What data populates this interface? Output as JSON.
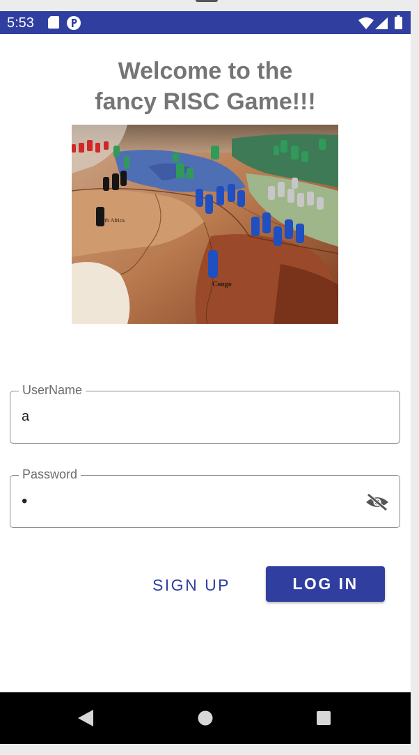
{
  "status_bar": {
    "time": "5:53",
    "background": "#303f9f",
    "icons": [
      "sd-card-icon",
      "p-notification-icon",
      "wifi-icon",
      "signal-icon",
      "battery-icon"
    ]
  },
  "title": {
    "line1": "Welcome to the",
    "line2": "fancy RISC Game!!!",
    "color": "#757575"
  },
  "board_image": {
    "labels": [
      "rth Africa",
      "Congo"
    ]
  },
  "username": {
    "label": "UserName",
    "value": "a"
  },
  "password": {
    "label": "Password",
    "value": "•",
    "toggle_icon": "eye-off-icon"
  },
  "buttons": {
    "sign_up": "SIGN UP",
    "log_in": "LOG IN",
    "accent": "#303f9f"
  },
  "nav_bar": {
    "icons": [
      "back-icon",
      "home-icon",
      "recents-icon"
    ]
  }
}
